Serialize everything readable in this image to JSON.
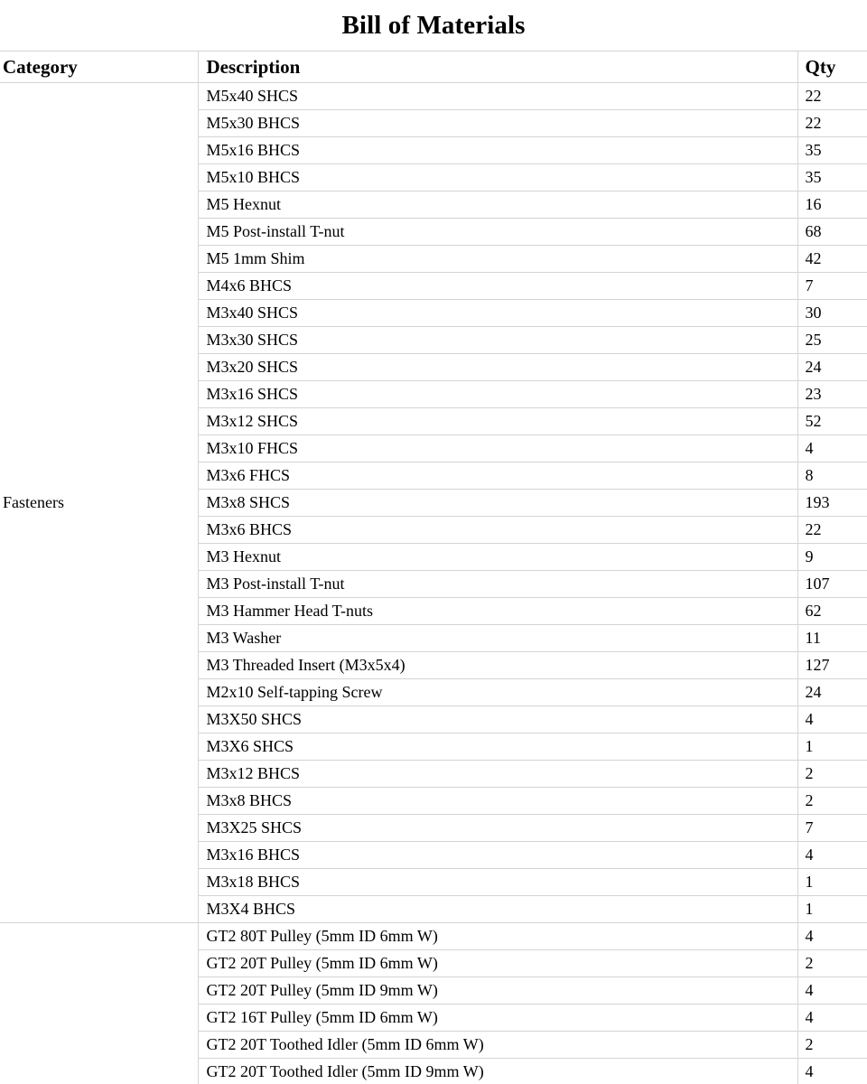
{
  "document": {
    "title": "Bill of Materials"
  },
  "table": {
    "columns": [
      {
        "key": "category",
        "label": "Category"
      },
      {
        "key": "description",
        "label": "Description"
      },
      {
        "key": "qty",
        "label": "Qty"
      }
    ],
    "sections": [
      {
        "category": "Fasteners",
        "rows": [
          {
            "description": "M5x40 SHCS",
            "qty": "22"
          },
          {
            "description": "M5x30 BHCS",
            "qty": "22"
          },
          {
            "description": "M5x16 BHCS",
            "qty": "35"
          },
          {
            "description": "M5x10 BHCS",
            "qty": "35"
          },
          {
            "description": "M5 Hexnut",
            "qty": "16"
          },
          {
            "description": "M5 Post-install T-nut",
            "qty": "68"
          },
          {
            "description": "M5 1mm Shim",
            "qty": "42"
          },
          {
            "description": "M4x6 BHCS",
            "qty": "7"
          },
          {
            "description": "M3x40 SHCS",
            "qty": "30"
          },
          {
            "description": "M3x30 SHCS",
            "qty": "25"
          },
          {
            "description": "M3x20 SHCS",
            "qty": "24"
          },
          {
            "description": "M3x16 SHCS",
            "qty": "23"
          },
          {
            "description": "M3x12 SHCS",
            "qty": "52"
          },
          {
            "description": "M3x10 FHCS",
            "qty": "4"
          },
          {
            "description": "M3x6 FHCS",
            "qty": "8"
          },
          {
            "description": "M3x8 SHCS",
            "qty": "193"
          },
          {
            "description": "M3x6 BHCS",
            "qty": "22"
          },
          {
            "description": "M3 Hexnut",
            "qty": "9"
          },
          {
            "description": "M3 Post-install T-nut",
            "qty": "107"
          },
          {
            "description": "M3 Hammer Head T-nuts",
            "qty": "62"
          },
          {
            "description": "M3 Washer",
            "qty": "11"
          },
          {
            "description": "M3 Threaded Insert (M3x5x4)",
            "qty": "127"
          },
          {
            "description": "M2x10 Self-tapping Screw",
            "qty": "24"
          },
          {
            "description": "M3X50 SHCS",
            "qty": "4"
          },
          {
            "description": "M3X6 SHCS",
            "qty": "1"
          },
          {
            "description": "M3x12 BHCS",
            "qty": "2"
          },
          {
            "description": "M3x8 BHCS",
            "qty": "2"
          },
          {
            "description": "M3X25 SHCS",
            "qty": "7"
          },
          {
            "description": "M3x16 BHCS",
            "qty": "4"
          },
          {
            "description": "M3x18 BHCS",
            "qty": "1"
          },
          {
            "description": "M3X4 BHCS",
            "qty": "1"
          }
        ]
      },
      {
        "category": "",
        "rows": [
          {
            "description": "GT2 80T Pulley (5mm ID 6mm W)",
            "qty": "4"
          },
          {
            "description": "GT2 20T Pulley (5mm ID 6mm W)",
            "qty": "2"
          },
          {
            "description": "GT2 20T Pulley (5mm ID 9mm W)",
            "qty": "4"
          },
          {
            "description": "GT2 16T Pulley (5mm ID 6mm W)",
            "qty": "4"
          },
          {
            "description": "GT2 20T Toothed Idler (5mm ID 6mm W)",
            "qty": "2"
          },
          {
            "description": "GT2 20T Toothed Idler (5mm ID 9mm W)",
            "qty": "4"
          }
        ]
      }
    ]
  },
  "style": {
    "border_color": "#d4d4d4",
    "text_color": "#000000",
    "background": "#ffffff"
  }
}
